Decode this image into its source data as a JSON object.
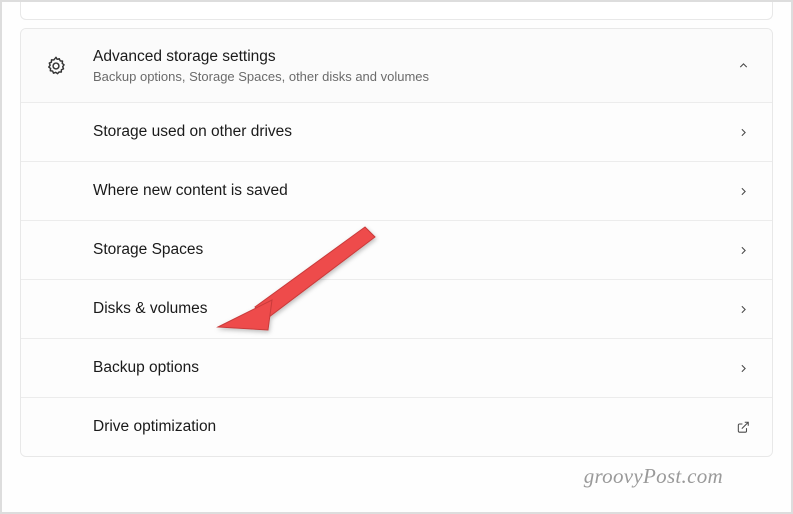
{
  "header": {
    "title": "Advanced storage settings",
    "subtitle": "Backup options, Storage Spaces, other disks and volumes"
  },
  "items": [
    {
      "label": "Storage used on other drives",
      "action": "navigate"
    },
    {
      "label": "Where new content is saved",
      "action": "navigate"
    },
    {
      "label": "Storage Spaces",
      "action": "navigate"
    },
    {
      "label": "Disks & volumes",
      "action": "navigate"
    },
    {
      "label": "Backup options",
      "action": "navigate"
    },
    {
      "label": "Drive optimization",
      "action": "open-external"
    }
  ],
  "watermark": "groovyPost.com"
}
